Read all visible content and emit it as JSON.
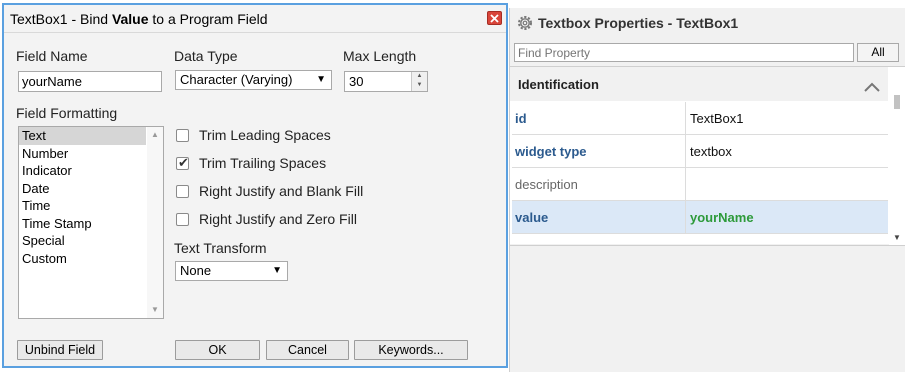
{
  "dialog": {
    "title_prefix": "TextBox1 - Bind ",
    "title_bold": "Value",
    "title_suffix": " to a Program Field",
    "field_name_label": "Field Name",
    "field_name_value": "yourName",
    "data_type_label": "Data Type",
    "data_type_value": "Character (Varying)",
    "max_length_label": "Max Length",
    "max_length_value": "30",
    "field_formatting_label": "Field Formatting",
    "formatting_options": [
      {
        "label": "Text",
        "selected": true
      },
      {
        "label": "Number",
        "selected": false
      },
      {
        "label": "Indicator",
        "selected": false
      },
      {
        "label": "Date",
        "selected": false
      },
      {
        "label": "Time",
        "selected": false
      },
      {
        "label": "Time Stamp",
        "selected": false
      },
      {
        "label": "Special",
        "selected": false
      },
      {
        "label": "Custom",
        "selected": false
      }
    ],
    "checkboxes": [
      {
        "label": "Trim Leading Spaces",
        "checked": false
      },
      {
        "label": "Trim Trailing Spaces",
        "checked": true
      },
      {
        "label": "Right Justify and Blank Fill",
        "checked": false
      },
      {
        "label": "Right Justify and Zero Fill",
        "checked": false
      }
    ],
    "text_transform_label": "Text Transform",
    "text_transform_value": "None",
    "buttons": {
      "unbind": "Unbind Field",
      "ok": "OK",
      "cancel": "Cancel",
      "keywords": "Keywords..."
    }
  },
  "properties": {
    "title": "Textbox Properties - TextBox1",
    "find_placeholder": "Find Property",
    "all_button": "All",
    "section": "Identification",
    "rows": [
      {
        "key": "id",
        "value": "TextBox1"
      },
      {
        "key": "widget type",
        "value": "textbox"
      },
      {
        "key": "description",
        "value": ""
      },
      {
        "key": "value",
        "value": "yourName"
      }
    ]
  }
}
